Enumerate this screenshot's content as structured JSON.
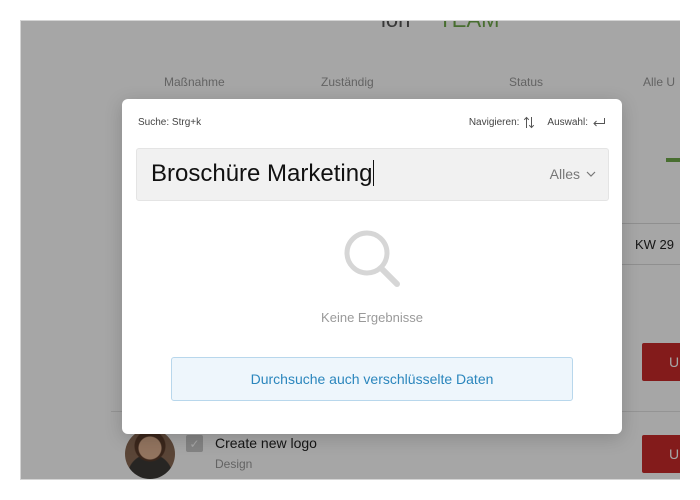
{
  "background": {
    "header_partial": "ion",
    "header_partial_green": "TEAM",
    "column_headers": [
      "Maßnahme",
      "Zuständig",
      "Status",
      "Alle U"
    ],
    "week_label": "KW 29",
    "red_button_label": "U",
    "task": {
      "title": "Create new logo",
      "category": "Design"
    }
  },
  "search_modal": {
    "hint_left": "Suche: Strg+k",
    "hint_navigate": "Navigieren:",
    "hint_select": "Auswahl:",
    "query": "Broschüre Marketing",
    "scope": "Alles",
    "empty_state": "Keine Ergebnisse",
    "encrypted_button": "Durchsuche auch verschlüsselte Daten"
  },
  "colors": {
    "accent_blue": "#2b86bd",
    "danger_red": "#c92a2a",
    "success_green": "#6fa94a"
  }
}
